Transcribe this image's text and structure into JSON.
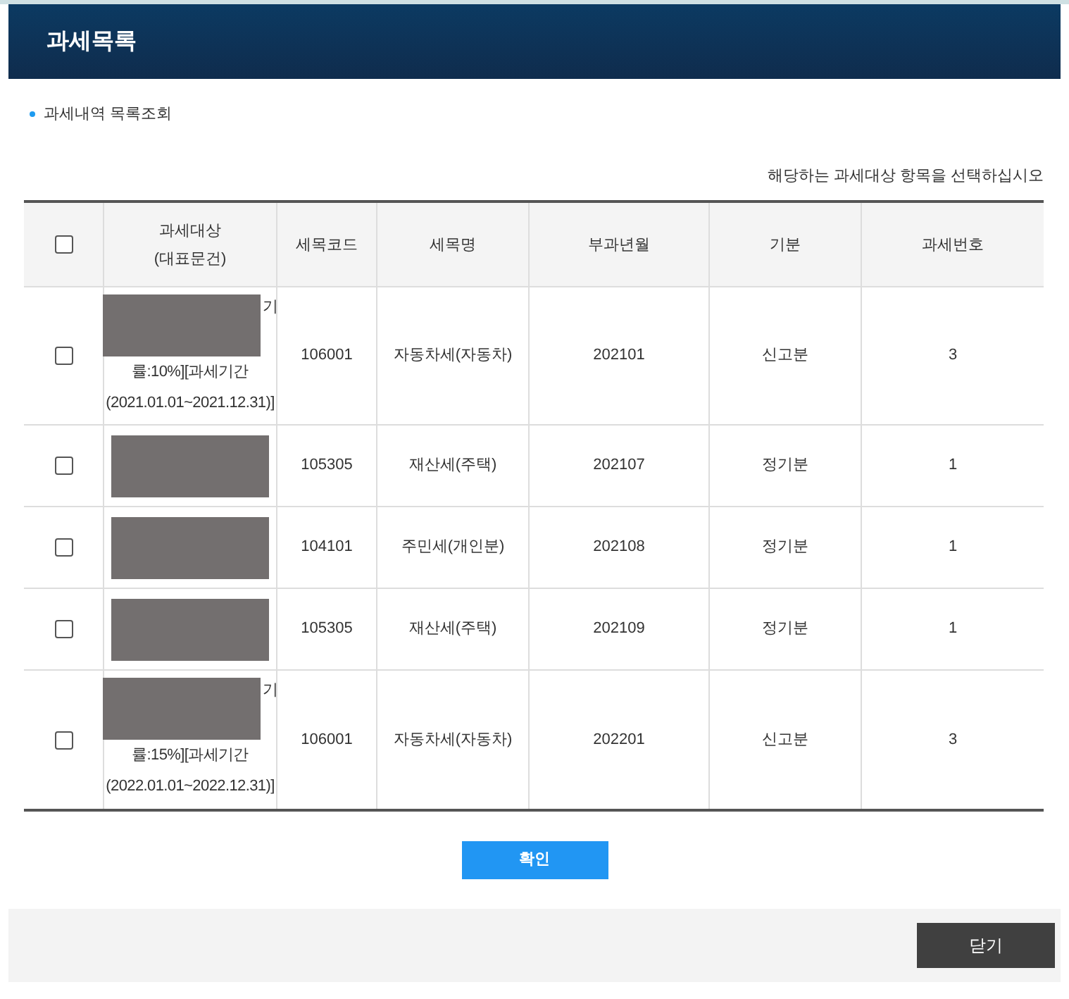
{
  "header": {
    "title": "과세목록"
  },
  "section": {
    "title": "과세내역 목록조회"
  },
  "instruction": "해당하는 과세대상 항목을 선택하십시오",
  "table": {
    "columns": [
      {
        "kind": "checkbox",
        "checked": false
      },
      {
        "kind": "text",
        "lines": [
          "과세대상",
          "(대표문건)"
        ]
      },
      {
        "kind": "text",
        "lines": [
          "세목코드"
        ]
      },
      {
        "kind": "text",
        "lines": [
          "세목명"
        ]
      },
      {
        "kind": "text",
        "lines": [
          "부과년월"
        ]
      },
      {
        "kind": "text",
        "lines": [
          "기분"
        ]
      },
      {
        "kind": "text",
        "lines": [
          "과세번호"
        ]
      }
    ],
    "rows": [
      {
        "cells": [
          {
            "kind": "checkbox",
            "checked": false
          },
          {
            "kind": "target",
            "redacted": true,
            "tail": "기",
            "lines": [
              "률:10%][과세기간",
              "(2021.01.01~2021.12.31)]"
            ]
          },
          {
            "kind": "text",
            "text": "106001"
          },
          {
            "kind": "text",
            "text": "자동차세(자동차)"
          },
          {
            "kind": "text",
            "text": "202101"
          },
          {
            "kind": "text",
            "text": "신고분"
          },
          {
            "kind": "text",
            "text": "3"
          }
        ]
      },
      {
        "cells": [
          {
            "kind": "checkbox",
            "checked": false
          },
          {
            "kind": "target",
            "redacted": true
          },
          {
            "kind": "text",
            "text": "105305"
          },
          {
            "kind": "text",
            "text": "재산세(주택)"
          },
          {
            "kind": "text",
            "text": "202107"
          },
          {
            "kind": "text",
            "text": "정기분"
          },
          {
            "kind": "text",
            "text": "1"
          }
        ]
      },
      {
        "cells": [
          {
            "kind": "checkbox",
            "checked": false
          },
          {
            "kind": "target",
            "redacted": true
          },
          {
            "kind": "text",
            "text": "104101"
          },
          {
            "kind": "text",
            "text": "주민세(개인분)"
          },
          {
            "kind": "text",
            "text": "202108"
          },
          {
            "kind": "text",
            "text": "정기분"
          },
          {
            "kind": "text",
            "text": "1"
          }
        ]
      },
      {
        "cells": [
          {
            "kind": "checkbox",
            "checked": false
          },
          {
            "kind": "target",
            "redacted": true
          },
          {
            "kind": "text",
            "text": "105305"
          },
          {
            "kind": "text",
            "text": "재산세(주택)"
          },
          {
            "kind": "text",
            "text": "202109"
          },
          {
            "kind": "text",
            "text": "정기분"
          },
          {
            "kind": "text",
            "text": "1"
          }
        ]
      },
      {
        "cells": [
          {
            "kind": "checkbox",
            "checked": false
          },
          {
            "kind": "target",
            "redacted": true,
            "tail": "기",
            "lines": [
              "률:15%][과세기간",
              "(2022.01.01~2022.12.31)]"
            ]
          },
          {
            "kind": "text",
            "text": "106001"
          },
          {
            "kind": "text",
            "text": "자동차세(자동차)"
          },
          {
            "kind": "text",
            "text": "202201"
          },
          {
            "kind": "text",
            "text": "신고분"
          },
          {
            "kind": "text",
            "text": "3"
          }
        ]
      }
    ]
  },
  "buttons": {
    "confirm": "확인",
    "close": "닫기"
  }
}
